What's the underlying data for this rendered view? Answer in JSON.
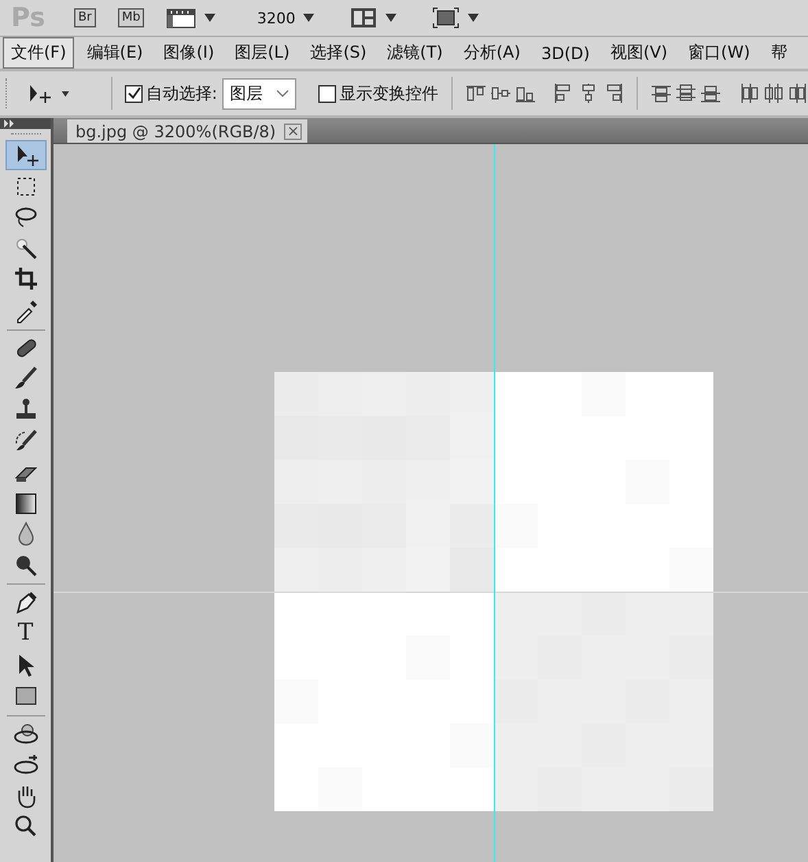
{
  "app_bar": {
    "logo": "Ps",
    "bridge_button": "Br",
    "mini_bridge_button": "Mb",
    "zoom_level": "3200"
  },
  "menu": [
    {
      "label": "文件(F)",
      "selected": true
    },
    {
      "label": "编辑(E)",
      "selected": false
    },
    {
      "label": "图像(I)",
      "selected": false
    },
    {
      "label": "图层(L)",
      "selected": false
    },
    {
      "label": "选择(S)",
      "selected": false
    },
    {
      "label": "滤镜(T)",
      "selected": false
    },
    {
      "label": "分析(A)",
      "selected": false
    },
    {
      "label": "3D(D)",
      "selected": false
    },
    {
      "label": "视图(V)",
      "selected": false
    },
    {
      "label": "窗口(W)",
      "selected": false
    },
    {
      "label": "帮",
      "selected": false
    }
  ],
  "options_bar": {
    "auto_select": {
      "label": "自动选择:",
      "checked": true
    },
    "auto_select_target": "图层",
    "show_transform": {
      "label": "显示变换控件",
      "checked": false
    }
  },
  "document_tab": {
    "title": "bg.jpg @ 3200%(RGB/8)",
    "close": "×"
  },
  "toolbox": {
    "groups": [
      {
        "tools": [
          {
            "selected": true
          },
          {
            "selected": false
          },
          {
            "selected": false
          },
          {
            "selected": false
          },
          {
            "selected": false
          },
          {
            "selected": false
          }
        ]
      },
      {
        "tools": [
          {
            "selected": false
          },
          {
            "selected": false
          },
          {
            "selected": false
          },
          {
            "selected": false
          },
          {
            "selected": false
          },
          {
            "selected": false
          },
          {
            "selected": false
          },
          {
            "selected": false
          }
        ]
      },
      {
        "tools": [
          {
            "selected": false
          },
          {
            "selected": false,
            "glyph": "T"
          },
          {
            "selected": false
          },
          {
            "selected": false
          }
        ]
      },
      {
        "tools": [
          {
            "selected": false
          },
          {
            "selected": false
          },
          {
            "selected": false
          },
          {
            "selected": false
          }
        ]
      }
    ]
  }
}
